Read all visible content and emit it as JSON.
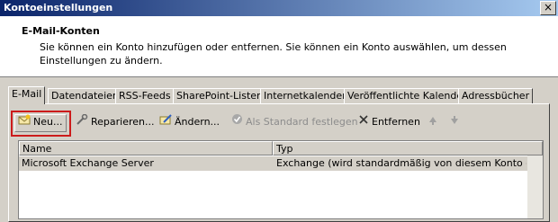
{
  "window": {
    "title": "Kontoeinstellungen",
    "close": "×"
  },
  "header": {
    "title": "E-Mail-Konten",
    "description": "Sie können ein Konto hinzufügen oder entfernen. Sie können ein Konto auswählen, um dessen Einstellungen zu ändern."
  },
  "tabs": [
    {
      "label": "E-Mail"
    },
    {
      "label": "Datendateien"
    },
    {
      "label": "RSS-Feeds"
    },
    {
      "label": "SharePoint-Listen"
    },
    {
      "label": "Internetkalender"
    },
    {
      "label": "Veröffentlichte Kalender"
    },
    {
      "label": "Adressbücher"
    }
  ],
  "toolbar": {
    "new": "Neu...",
    "repair": "Reparieren...",
    "change": "Ändern...",
    "set_default": "Als Standard festlegen",
    "remove": "Entfernen"
  },
  "list": {
    "columns": [
      "Name",
      "Typ"
    ],
    "rows": [
      {
        "name": "Microsoft Exchange Server",
        "type": "Exchange (wird standardmäßig von diesem Konto ges..."
      }
    ]
  },
  "colors": {
    "title_start": "#0a246a",
    "title_end": "#a6caf0",
    "highlight": "#cc1b1b"
  }
}
